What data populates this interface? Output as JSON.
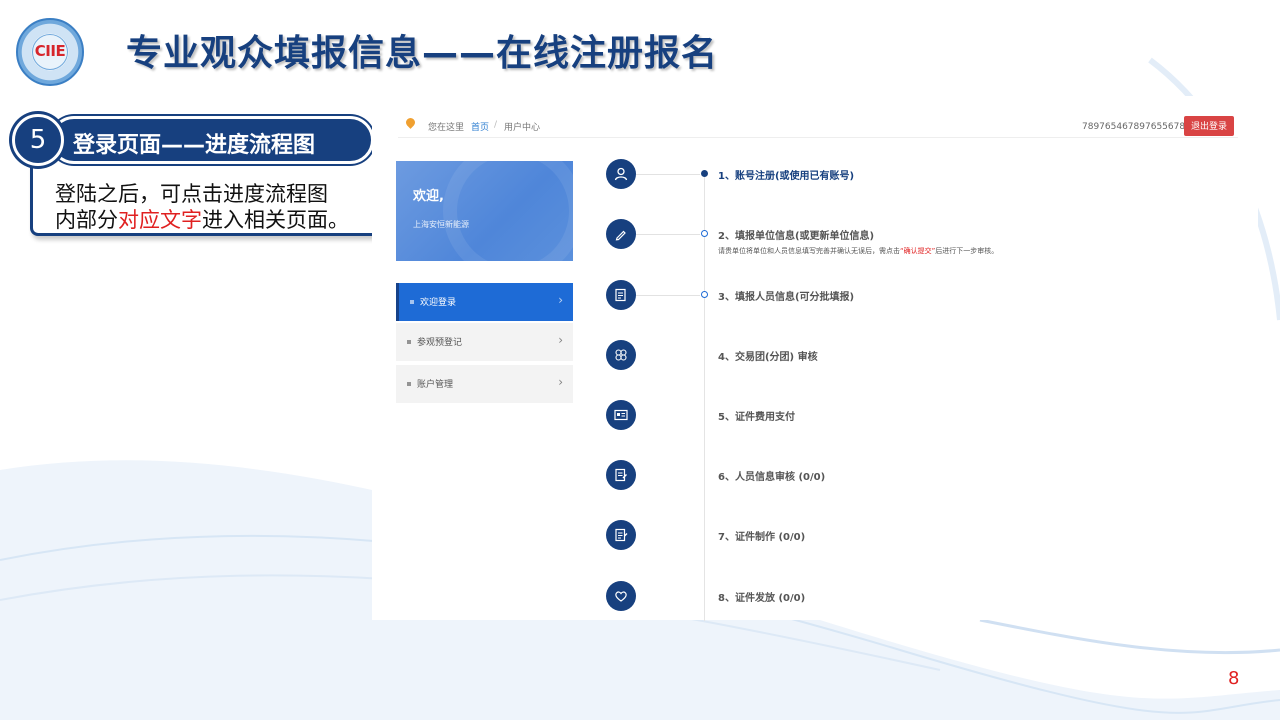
{
  "slide": {
    "title": "专业观众填报信息——在线注册报名",
    "logo_text": "CIIE",
    "page_number": "8"
  },
  "callout": {
    "step_number": "5",
    "step_title": "登录页面——进度流程图",
    "desc_line1": "登陆之后，可点击进度流程图",
    "desc_line2_a": "内部分",
    "desc_line2_highlight": "对应文字",
    "desc_line2_b": "进入相关页面。"
  },
  "portal": {
    "breadcrumb": {
      "prefix": "您在这里",
      "home": "首页",
      "separator": "/",
      "current": "用户中心"
    },
    "account_id": "789765467897655678",
    "logout_label": "退出登录",
    "welcome": {
      "title": "欢迎,",
      "org": "上海安恒新能源"
    },
    "menu": [
      {
        "label": "欢迎登录",
        "active": true
      },
      {
        "label": "参观预登记",
        "active": false
      },
      {
        "label": "账户管理",
        "active": false
      }
    ],
    "steps": [
      {
        "label": "1、账号注册(或使用已有账号)",
        "icon": "user-icon",
        "state": "done"
      },
      {
        "label": "2、填报单位信息(或更新单位信息)",
        "icon": "pencil-icon",
        "state": "pending",
        "note_a": "请贵单位将单位和人员信息填写完善并确认无误后，需点击",
        "note_hl": "“确认提交”",
        "note_b": "后进行下一步审核。"
      },
      {
        "label": "3、填报人员信息(可分批填报)",
        "icon": "form-icon",
        "state": "pending"
      },
      {
        "label": "4、交易团(分团) 审核",
        "icon": "group-icon",
        "state": "none"
      },
      {
        "label": "5、证件费用支付",
        "icon": "card-icon",
        "state": "none"
      },
      {
        "label": "6、人员信息审核 (0/0)",
        "icon": "review-icon",
        "state": "none"
      },
      {
        "label": "7、证件制作 (0/0)",
        "icon": "document-icon",
        "state": "none"
      },
      {
        "label": "8、证件发放 (0/0)",
        "icon": "heart-icon",
        "state": "none"
      }
    ]
  }
}
